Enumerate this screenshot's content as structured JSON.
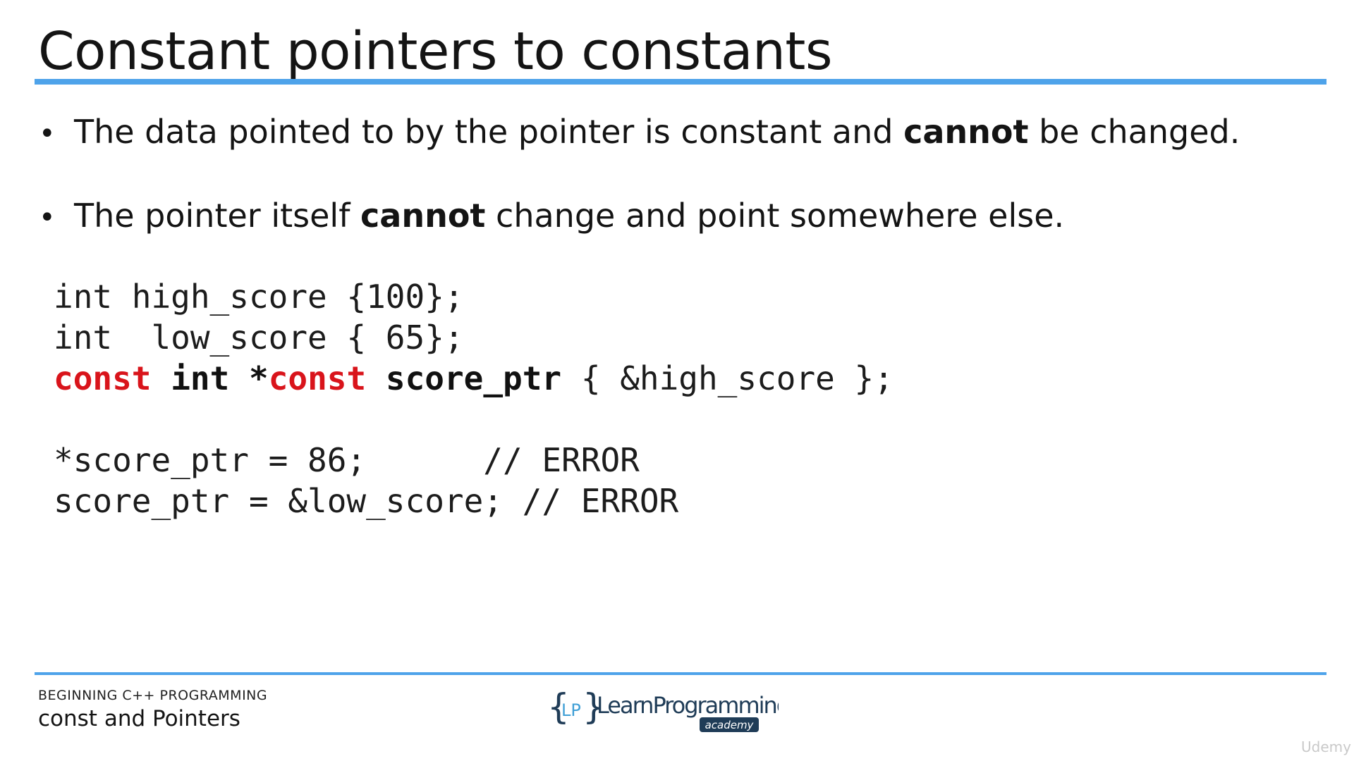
{
  "slide": {
    "title": "Constant pointers to constants",
    "bullets": [
      {
        "before": "The data pointed to by the pointer is constant and ",
        "bold": "cannot",
        "after": " be changed."
      },
      {
        "before": "The pointer itself ",
        "bold": "cannot",
        "after": " change and point somewhere else."
      }
    ],
    "code": {
      "line1": "int high_score {100};",
      "line2": "int  low_score { 65};",
      "line3": {
        "kw_const1": "const",
        "sp1": " ",
        "kw_int": "int",
        "sp2": " ",
        "star": "*",
        "kw_const2": "const",
        "sp3": " ",
        "name": "score_ptr",
        "rest": " { &high_score };"
      },
      "line4": "*score_ptr = 86;      // ERROR",
      "line5": "score_ptr = &low_score; // ERROR"
    }
  },
  "footer": {
    "course": "BEGINNING C++ PROGRAMMING",
    "section": "const and Pointers",
    "logo_text": "LearnProgramming",
    "logo_sub": "academy",
    "logo_initials": "LP",
    "watermark": "Udemy"
  },
  "colors": {
    "accent_rule": "#4ea3ea",
    "keyword_red": "#d9141b",
    "logo_blue": "#3f9fd6",
    "logo_dark": "#1f3c57"
  }
}
